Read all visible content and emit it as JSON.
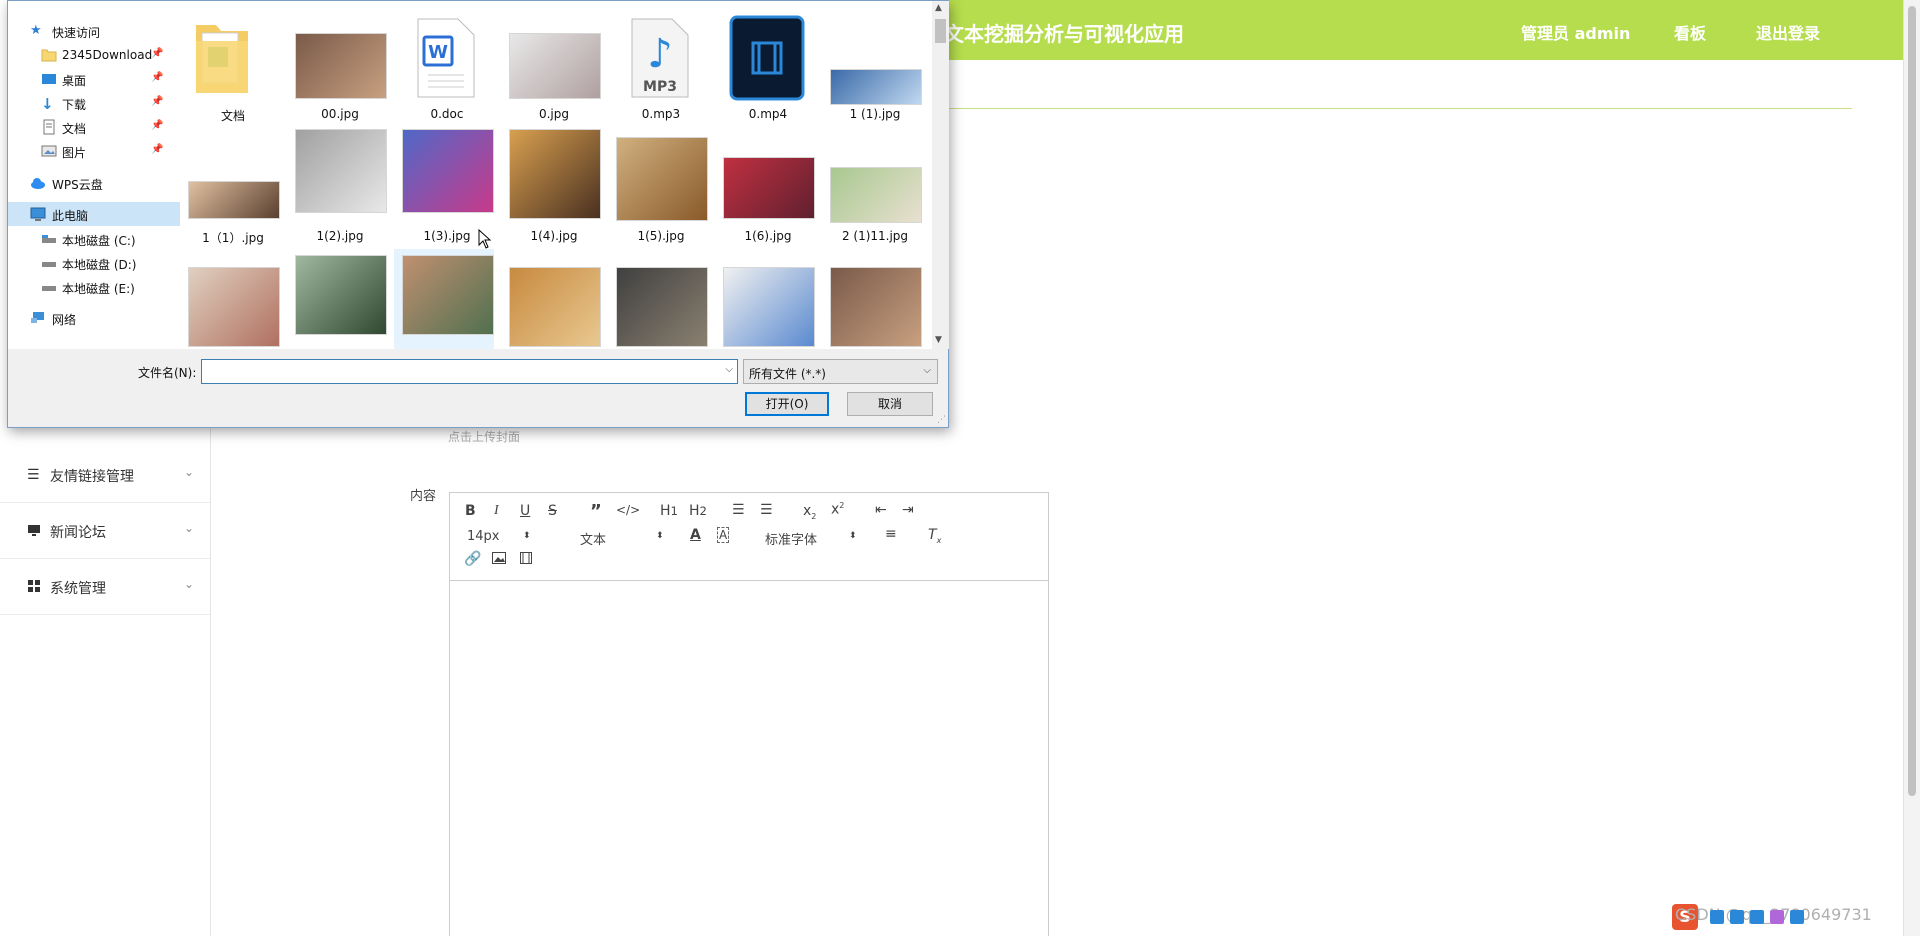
{
  "app": {
    "title": "文本挖掘分析与可视化应用",
    "nav_user": "管理员 admin",
    "nav_dashboard": "看板",
    "nav_logout": "退出登录",
    "accent_color": "#b6dd4d"
  },
  "sidebar": {
    "items": [
      {
        "label": "友情链接管理",
        "icon": "list-icon"
      },
      {
        "label": "新闻论坛",
        "icon": "monitor-icon"
      },
      {
        "label": "系统管理",
        "icon": "grid-icon"
      }
    ]
  },
  "form": {
    "upload_hint": "点击上传封面",
    "content_label": "内容"
  },
  "editor": {
    "font_size": "14px",
    "paragraph": "文本",
    "font_family": "标准字体"
  },
  "dialog": {
    "nav": [
      {
        "label": "快速访问",
        "icon": "star-icon"
      },
      {
        "label": "2345Download",
        "icon": "folder-icon",
        "pinned": true
      },
      {
        "label": "桌面",
        "icon": "desktop-icon",
        "pinned": true
      },
      {
        "label": "下载",
        "icon": "download-icon",
        "pinned": true
      },
      {
        "label": "文档",
        "icon": "document-icon",
        "pinned": true
      },
      {
        "label": "图片",
        "icon": "picture-icon",
        "pinned": true
      },
      {
        "label": "WPS云盘",
        "icon": "cloud-icon"
      },
      {
        "label": "此电脑",
        "icon": "computer-icon"
      },
      {
        "label": "本地磁盘 (C:)",
        "icon": "drive-icon"
      },
      {
        "label": "本地磁盘 (D:)",
        "icon": "drive-icon"
      },
      {
        "label": "本地磁盘 (E:)",
        "icon": "drive-icon"
      },
      {
        "label": "网络",
        "icon": "network-icon"
      }
    ],
    "files": [
      {
        "name": "文档",
        "kind": "folder"
      },
      {
        "name": "00.jpg",
        "kind": "image"
      },
      {
        "name": "0.doc",
        "kind": "doc"
      },
      {
        "name": "0.jpg",
        "kind": "image"
      },
      {
        "name": "0.mp3",
        "kind": "mp3"
      },
      {
        "name": "0.mp4",
        "kind": "mp4"
      },
      {
        "name": "1 (1).jpg",
        "kind": "image"
      },
      {
        "name": "1（1）.jpg",
        "kind": "image"
      },
      {
        "name": "1(2).jpg",
        "kind": "image"
      },
      {
        "name": "1(3).jpg",
        "kind": "image"
      },
      {
        "name": "1(4).jpg",
        "kind": "image"
      },
      {
        "name": "1(5).jpg",
        "kind": "image"
      },
      {
        "name": "1(6).jpg",
        "kind": "image"
      },
      {
        "name": "2 (1)11.jpg",
        "kind": "image"
      },
      {
        "name": "",
        "kind": "image"
      },
      {
        "name": "",
        "kind": "image"
      },
      {
        "name": "",
        "kind": "image"
      },
      {
        "name": "",
        "kind": "image"
      },
      {
        "name": "",
        "kind": "image"
      },
      {
        "name": "",
        "kind": "image"
      },
      {
        "name": "",
        "kind": "image"
      }
    ],
    "filename_label": "文件名(N):",
    "filename_value": "",
    "filter": "所有文件 (*.*)",
    "open_label": "打开(O)",
    "cancel_label": "取消"
  },
  "watermark": "CSDN @qq_3780649731"
}
